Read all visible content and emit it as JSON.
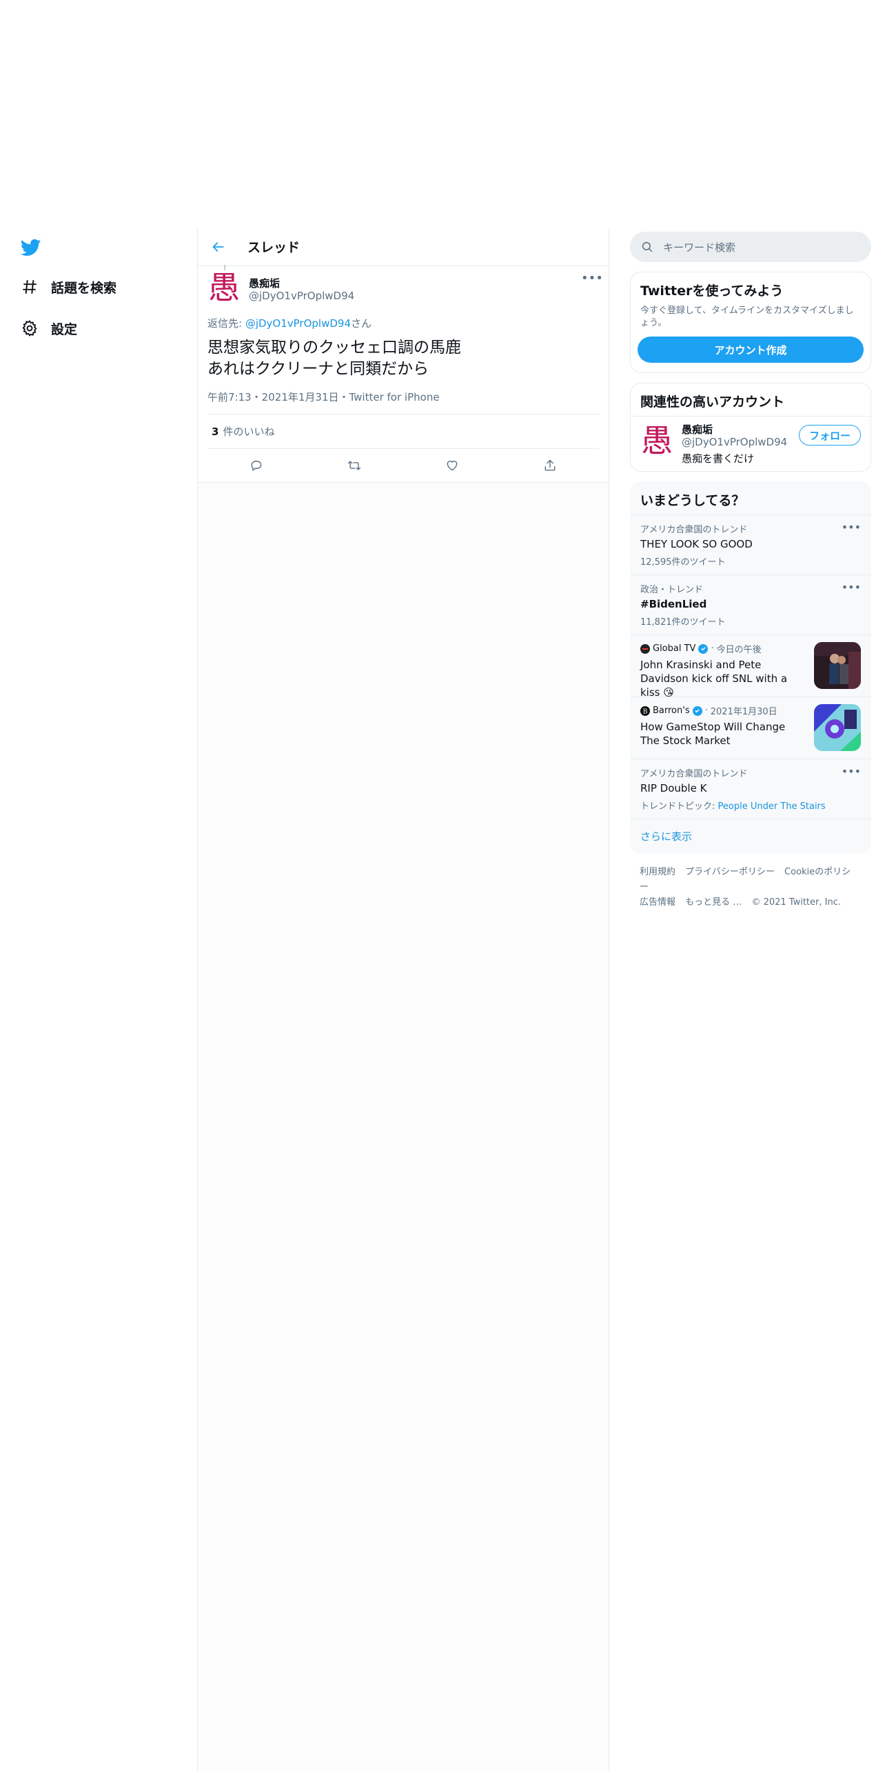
{
  "nav": {
    "items": [
      {
        "label": "話題を検索",
        "icon": "hashtag-icon"
      },
      {
        "label": "設定",
        "icon": "gear-icon"
      }
    ]
  },
  "thread": {
    "title": "スレッド",
    "tweet": {
      "avatar_char": "愚",
      "author_name": "愚痴垢",
      "author_handle": "@jDyO1vPrOplwD94",
      "reply_prefix": "返信先: ",
      "reply_handle": "@jDyO1vPrOplwD94",
      "reply_suffix": "さん",
      "text": "思想家気取りのクッセェ口調の馬鹿\nあれはククリーナと同類だから",
      "meta": "午前7:13・2021年1月31日・Twitter for iPhone",
      "likes_count": "3",
      "likes_label": "件のいいね"
    }
  },
  "sidebar": {
    "search_placeholder": "キーワード検索",
    "signup": {
      "title": "Twitterを使ってみよう",
      "description": "今すぐ登録して、タイムラインをカスタマイズしましょう。",
      "button": "アカウント作成"
    },
    "related": {
      "title": "関連性の高いアカウント",
      "account": {
        "avatar_char": "愚",
        "name": "愚痴垢",
        "handle": "@jDyO1vPrOplwD94",
        "bio": "愚痴を書くだけ",
        "follow_label": "フォロー"
      }
    },
    "trends": {
      "title": "いまどうしてる？",
      "items": [
        {
          "context": "アメリカ合衆国のトレンド",
          "topic": "THEY LOOK SO GOOD",
          "count": "12,595件のツイート"
        },
        {
          "context": "政治・トレンド",
          "topic": "#BidenLied",
          "count": "11,821件のツイート"
        }
      ],
      "news": [
        {
          "source": "Global TV",
          "time": "今日の午後",
          "headline": "John Krasinski and Pete Davidson kick off SNL with a kiss 😘"
        },
        {
          "source": "Barron's",
          "time": "2021年1月30日",
          "headline": "How GameStop Will Change The Stock Market"
        }
      ],
      "last": {
        "context": "アメリカ合衆国のトレンド",
        "topic": "RIP Double K",
        "related_prefix": "トレンドトピック: ",
        "related": "People Under The Stairs"
      },
      "show_more": "さらに表示"
    },
    "footer": {
      "links": [
        "利用規約",
        "プライバシーポリシー",
        "Cookieのポリシー",
        "広告情報",
        "もっと見る …",
        "© 2021 Twitter, Inc."
      ]
    }
  },
  "colors": {
    "accent": "#1da1f2",
    "link": "#1b95e0",
    "avatar": "#c2185b",
    "muted": "#5b7083"
  }
}
